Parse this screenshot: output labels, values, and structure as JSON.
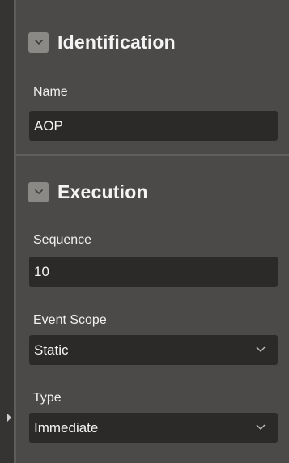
{
  "sections": {
    "identification": {
      "title": "Identification",
      "fields": {
        "name": {
          "label": "Name",
          "value": "AOP"
        }
      }
    },
    "execution": {
      "title": "Execution",
      "fields": {
        "sequence": {
          "label": "Sequence",
          "value": "10"
        },
        "event_scope": {
          "label": "Event Scope",
          "value": "Static"
        },
        "type": {
          "label": "Type",
          "value": "Immediate"
        }
      }
    }
  },
  "icons": {
    "collapse": "chevron-down-icon",
    "select": "chevron-down-icon",
    "rail": "triangle-right-icon"
  },
  "colors": {
    "panel_bg": "#4b4a48",
    "input_bg": "#2b2a29",
    "toggle_bg": "#8a8986",
    "text": "#f2f2f2"
  }
}
